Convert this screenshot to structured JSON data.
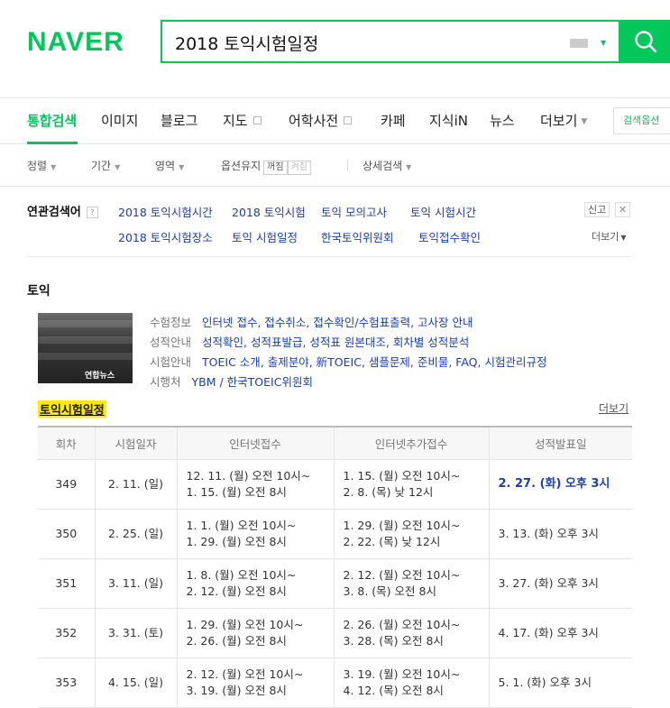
{
  "header": {
    "logo": "NAVER",
    "search_value": "2018 토익시험일정"
  },
  "tabs": {
    "items": [
      "통합검색",
      "이미지",
      "블로그",
      "지도",
      "어학사전",
      "카페",
      "지식iN",
      "뉴스",
      "더보기"
    ],
    "search_options": "검색옵션"
  },
  "filters": {
    "sort": "정렬",
    "period": "기간",
    "area": "영역",
    "option_keep": "옵션유지",
    "on": "꺼짐",
    "off": "켜짐",
    "detail": "상세검색"
  },
  "related": {
    "label": "연관검색어",
    "help": "?",
    "items": [
      "2018 토익시험시간",
      "2018 토익시험",
      "토익 모의고사",
      "토익 시험시간",
      "2018 토익시험장소",
      "토익 시험일정",
      "한국토익위원회",
      "토익접수확인"
    ],
    "report": "신고",
    "close": "✕",
    "more": "더보기"
  },
  "toeic": {
    "title": "토익",
    "thumb_watermark": "연합뉴스",
    "info": [
      {
        "key": "수험정보",
        "value": "인터넷 접수, 접수취소, 접수확인/수험표출력, 고사장 안내"
      },
      {
        "key": "성적안내",
        "value": "성적확인, 성적표발급, 성적표 원본대조, 회차별 성적분석"
      },
      {
        "key": "시험안내",
        "value": "TOEIC 소개, 출제분야, 新TOEIC, 샘플문제, 준비물, FAQ, 시험관리규정"
      },
      {
        "key": "시행처",
        "value": "YBM / 한국TOEIC위원회"
      }
    ],
    "schedule_title": "토익시험일정",
    "more": "더보기",
    "table": {
      "headers": [
        "회차",
        "시험일자",
        "인터넷접수",
        "인터넷추가접수",
        "성적발표일"
      ],
      "rows": [
        [
          "349",
          "2. 11. (일)",
          "12. 11. (월) 오전 10시~",
          "1. 15. (월) 오전 8시",
          "1. 15. (월) 오전 10시~",
          "2. 8. (목) 낮 12시",
          "2. 27. (화) 오후 3시"
        ],
        [
          "350",
          "2. 25. (일)",
          "1. 1. (월) 오전 10시~",
          "1. 29. (월) 오전 8시",
          "1. 29. (월) 오전 10시~",
          "2. 22. (목) 낮 12시",
          "3. 13. (화) 오후 3시"
        ],
        [
          "351",
          "3. 11. (일)",
          "1. 8. (월) 오전 10시~",
          "2. 12. (월) 오전 8시",
          "2. 12. (월) 오전 10시~",
          "3. 8. (목) 오전 8시",
          "3. 27. (화) 오후 3시"
        ],
        [
          "352",
          "3. 31. (토)",
          "1. 29. (월) 오전 10시~",
          "2. 26. (월) 오전 8시",
          "2. 26. (월) 오전 10시~",
          "3. 28. (목) 오전 8시",
          "4. 17. (화) 오후 3시"
        ],
        [
          "353",
          "4. 15. (일)",
          "2. 12. (월) 오전 10시~",
          "3. 19. (월) 오전 8시",
          "3. 19. (월) 오전 10시~",
          "4. 12. (목) 오전 8시",
          "5. 1. (화) 오후 3시"
        ]
      ]
    }
  },
  "colors": {
    "brand": "#03c75a",
    "link": "#1a3dbb",
    "highlight": "#ffea00"
  }
}
